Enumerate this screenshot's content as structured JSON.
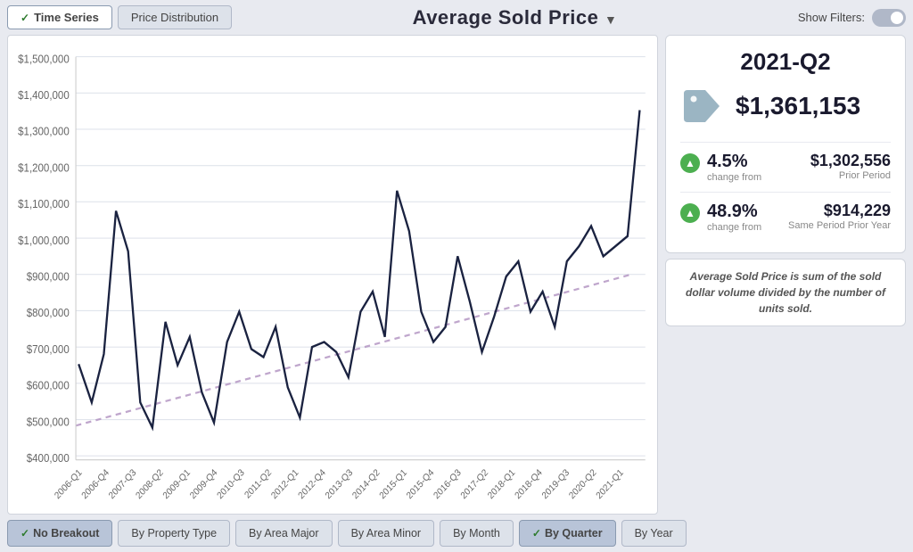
{
  "header": {
    "tab_timeseries_label": "Time Series",
    "tab_pricedist_label": "Price Distribution",
    "chart_title": "Average Sold Price",
    "show_filters_label": "Show Filters:"
  },
  "stats": {
    "quarter": "2021-Q2",
    "main_price": "$1,361,153",
    "change1_pct": "4.5%",
    "change1_label": "change from",
    "change1_value": "$1,302,556",
    "change1_period": "Prior Period",
    "change2_pct": "48.9%",
    "change2_label": "change from",
    "change2_value": "$914,229",
    "change2_period": "Same Period Prior Year",
    "disclaimer": "Average Sold Price is sum of the sold dollar volume divided by the number of units sold."
  },
  "breakout": {
    "no_breakout": "No Breakout",
    "by_property_type": "By Property Type",
    "by_area_major": "By Area Major",
    "by_area_minor": "By Area Minor",
    "by_month": "By Month",
    "by_quarter": "By Quarter",
    "by_year": "By Year"
  },
  "chart": {
    "y_labels": [
      "$1,500,000",
      "$1,400,000",
      "$1,300,000",
      "$1,200,000",
      "$1,100,000",
      "$1,000,000",
      "$900,000",
      "$800,000",
      "$700,000",
      "$600,000",
      "$500,000",
      "$400,000"
    ],
    "x_labels": [
      "2006-Q1",
      "2006-Q4",
      "2007-Q3",
      "2008-Q2",
      "2009-Q1",
      "2009-Q4",
      "2010-Q3",
      "2011-Q2",
      "2012-Q1",
      "2012-Q4",
      "2013-Q3",
      "2014-Q2",
      "2015-Q1",
      "2015-Q4",
      "2016-Q3",
      "2017-Q2",
      "2018-Q1",
      "2018-Q4",
      "2019-Q3",
      "2020-Q2",
      "2021-Q1"
    ]
  }
}
